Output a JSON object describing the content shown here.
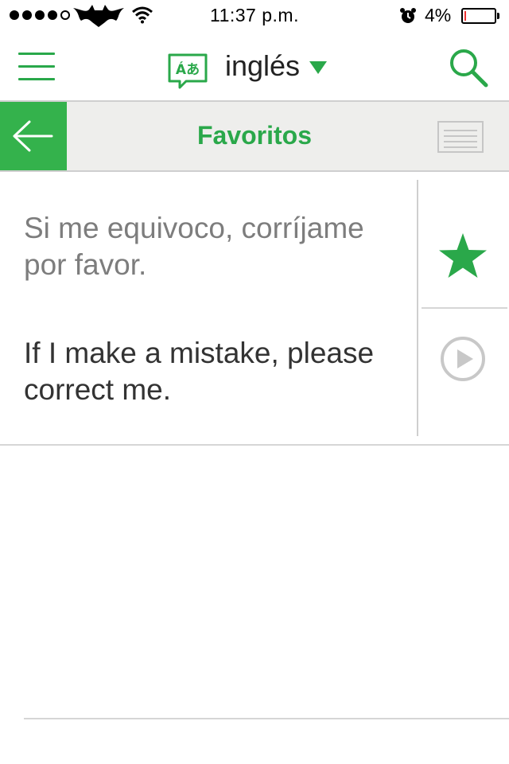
{
  "status_bar": {
    "time": "11:37 p.m.",
    "battery_percent": "4%",
    "battery_level": 0.04,
    "signal_bars": 4,
    "carrier_icon": "bat-logo-icon",
    "wifi_icon": "wifi-icon",
    "alarm_icon": "alarm-icon"
  },
  "header": {
    "menu_icon": "hamburger-menu-icon",
    "language_icon": "translate-icon",
    "language_icon_text": "Áあ",
    "language": "inglés",
    "search_icon": "search-icon"
  },
  "subheader": {
    "back_icon": "arrow-left-icon",
    "title": "Favoritos",
    "list_icon": "list-icon"
  },
  "favorite": {
    "source_text": "Si me equivoco, corríjame por favor.",
    "translation_text": "If I make a mistake, please correct me.",
    "star_icon": "star-icon",
    "play_icon": "play-icon",
    "is_favorite": true
  },
  "colors": {
    "accent": "#2aa84a",
    "back_button_bg": "#34b24c",
    "subheader_bg": "#eeeeec",
    "source_text": "#7d7d7d",
    "translation_text": "#333333"
  }
}
